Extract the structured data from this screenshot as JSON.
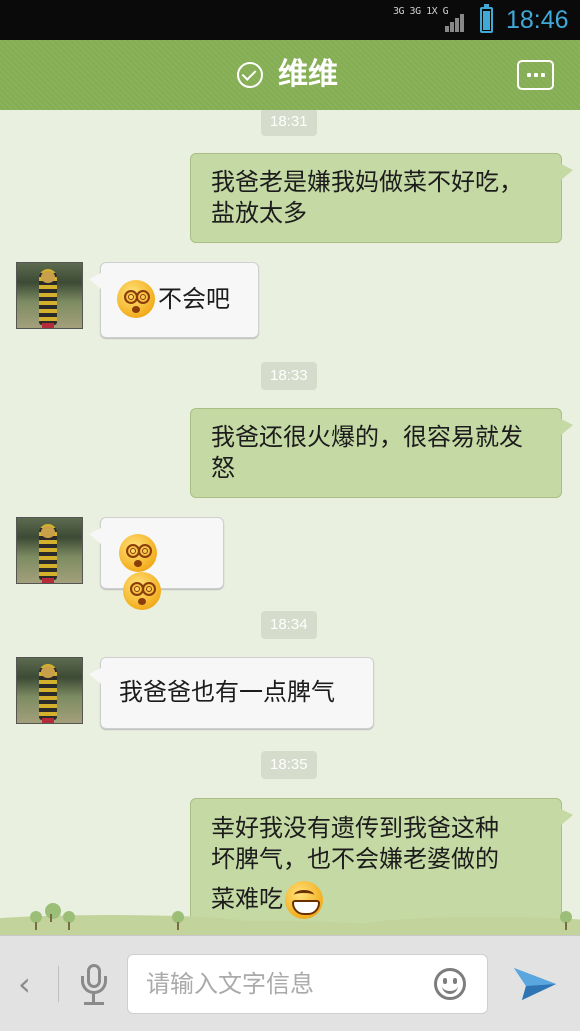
{
  "status_bar": {
    "network_indicators": "3G 3G 1X G",
    "time": "18:46",
    "battery_level": 0.85,
    "accent_color": "#3fa9d8"
  },
  "header": {
    "title": "维维",
    "status_icon": "check-circle-icon",
    "menu_icon": "more-options-icon",
    "color": "#84ad54"
  },
  "chat": {
    "timestamps": [
      "18:31",
      "18:33",
      "18:34",
      "18:35"
    ],
    "messages": [
      {
        "from": "me",
        "text": "我爸老是嫌我妈做菜不好吃，盐放太多"
      },
      {
        "from": "them",
        "text": "不会吧",
        "emoji": [
          "dizzy-face-emoji"
        ]
      },
      {
        "from": "me",
        "text": "我爸还很火爆的，很容易就发怒"
      },
      {
        "from": "them",
        "text": "",
        "emoji": [
          "dizzy-face-emoji",
          "dizzy-face-emoji"
        ]
      },
      {
        "from": "them",
        "text": "我爸爸也有一点脾气"
      },
      {
        "from": "me",
        "text_line1": "幸好我没有遗传到我爸这种",
        "text_line2": "坏脾气，也不会嫌老婆做的",
        "text_line3": "菜难吃",
        "emoji": [
          "grinning-face-emoji"
        ]
      }
    ]
  },
  "input_bar": {
    "back_label": "‹",
    "placeholder": "请输入文字信息",
    "icons": [
      "back-chevron-icon",
      "microphone-icon",
      "smiley-icon",
      "send-icon"
    ]
  }
}
